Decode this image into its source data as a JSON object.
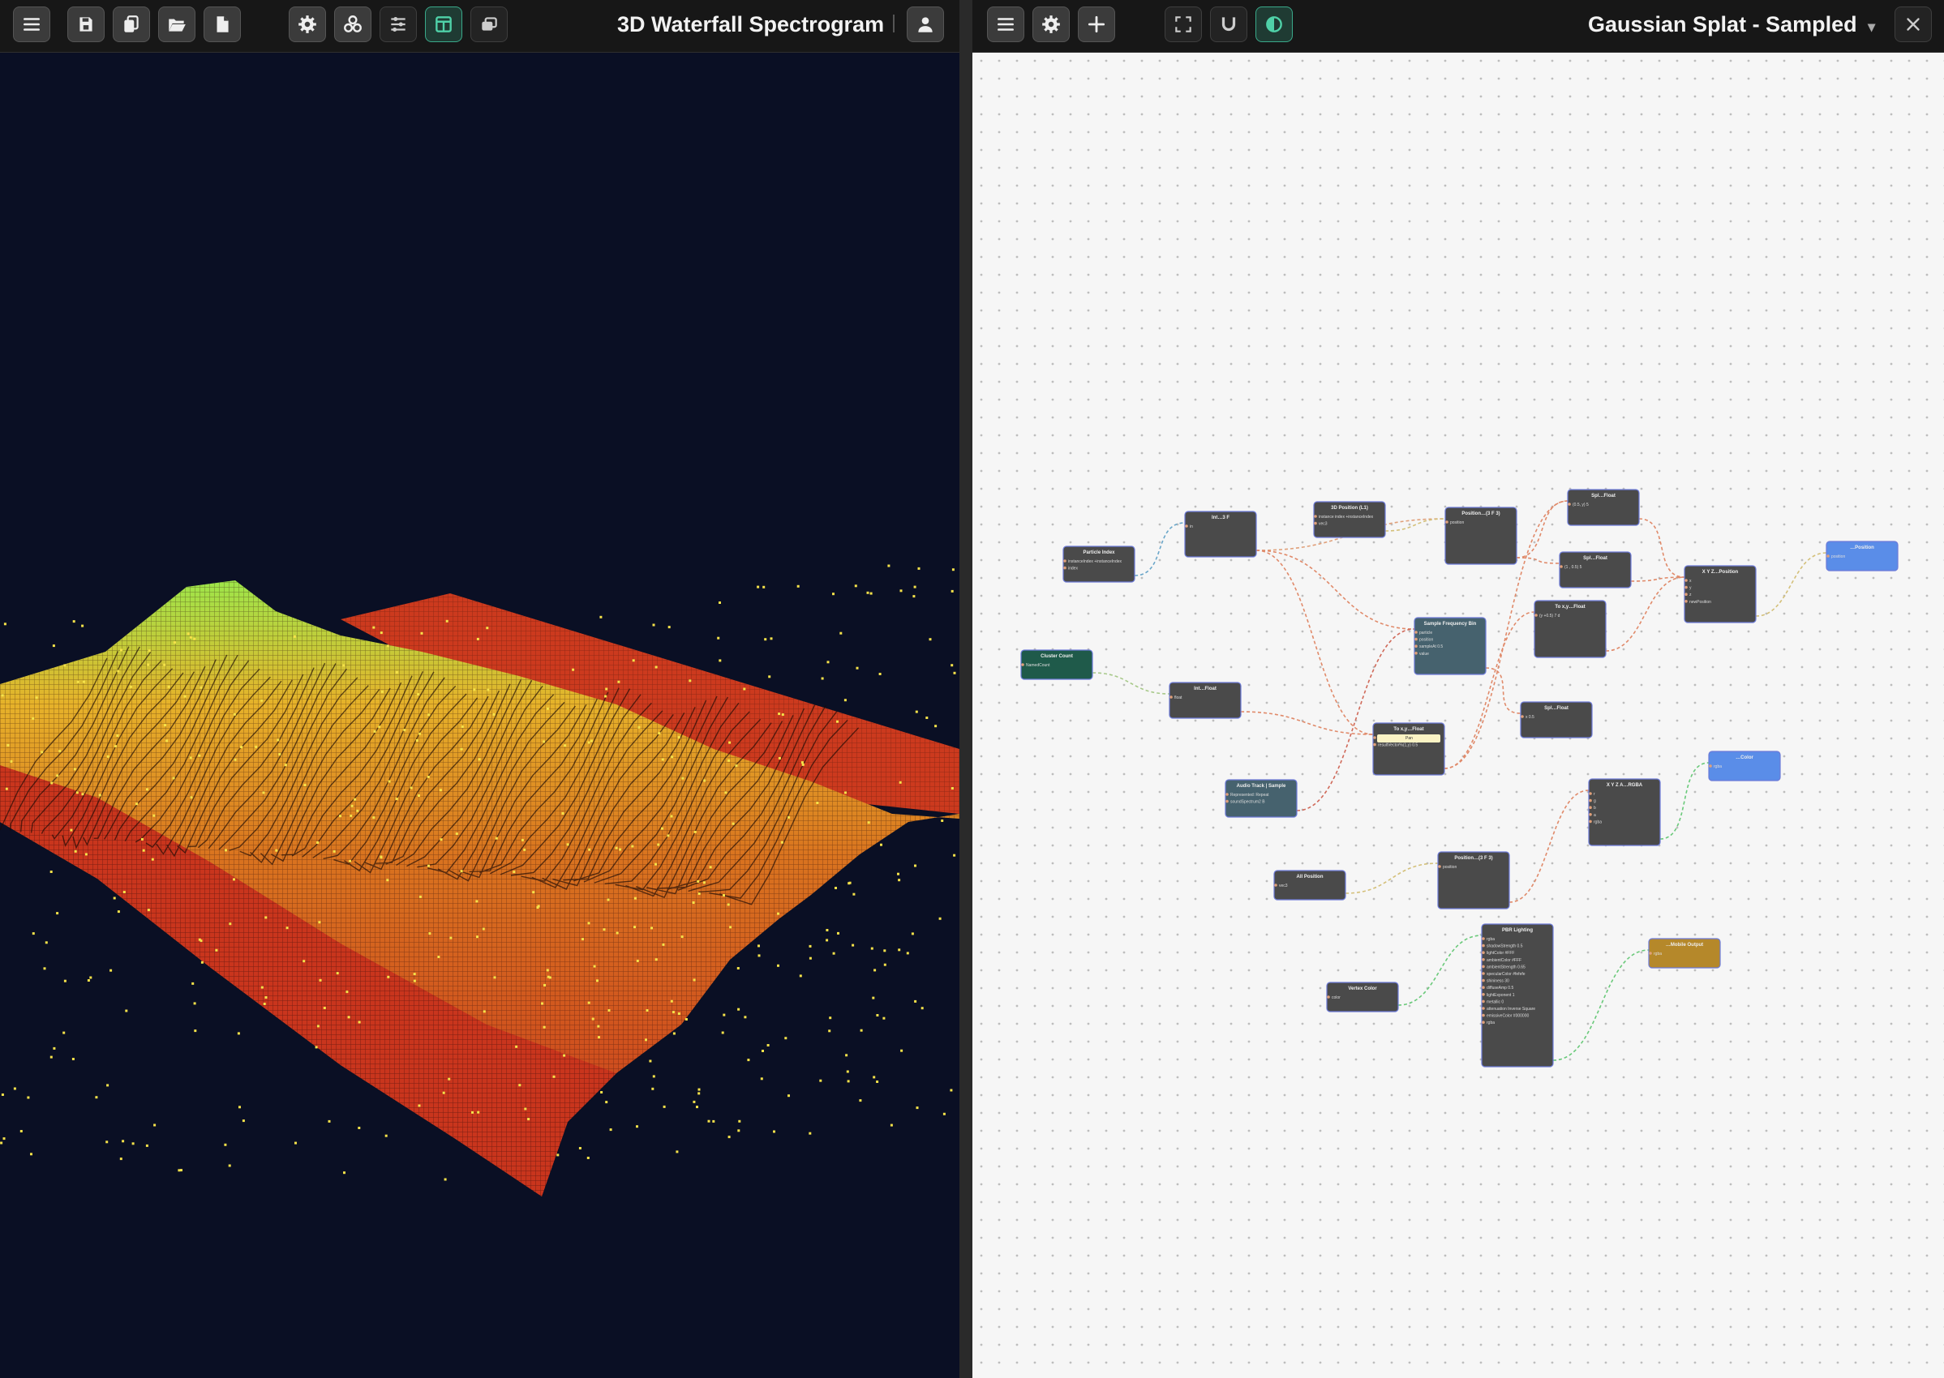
{
  "left_window": {
    "title": "3D Waterfall Spectrogram",
    "toolbar_icons": [
      "menu-icon",
      "save-icon",
      "copy-icon",
      "folder-open-icon",
      "file-icon",
      "gear-icon",
      "nodes-icon",
      "sliders-icon",
      "layout-split-icon",
      "windows-icon",
      "user-icon"
    ],
    "colors": {
      "background": "#0a0f24",
      "low": "#c8361e",
      "mid": "#e6b22a",
      "high": "#9de64a"
    }
  },
  "right_window": {
    "title": "Gaussian Splat - Sampled",
    "dropdown_arrow": "▾",
    "toolbar_icons": [
      "menu-icon",
      "gear-icon",
      "plus-icon",
      "fullscreen-icon",
      "magnet-icon",
      "contrast-icon",
      "close-icon"
    ],
    "nodes": [
      {
        "id": "n1",
        "title": "Particle Index",
        "lines": [
          "instanceIndex +instanceIndex",
          "index"
        ]
      },
      {
        "id": "n2",
        "title": "Int…3 F",
        "lines": [
          "in"
        ]
      },
      {
        "id": "n3",
        "title": "3D Position (L1)",
        "lines": [
          "instance index +instanceIndex",
          "vec3"
        ]
      },
      {
        "id": "n4",
        "title": "Position…(3 F 3)",
        "lines": [
          "position"
        ]
      },
      {
        "id": "n5",
        "title": "Spl…Float",
        "lines": [
          "(0.5, y) 5"
        ]
      },
      {
        "id": "n6",
        "title": "Spl…Float",
        "lines": [
          "(1 , 0.5) 5"
        ]
      },
      {
        "id": "n7",
        "title": "X Y Z…Position",
        "lines": [
          "x",
          "y",
          "z",
          "newPosition"
        ]
      },
      {
        "id": "n8",
        "title": "…Position",
        "lines": [
          "position"
        ]
      },
      {
        "id": "n9",
        "title": "Cluster Count",
        "lines": [
          "NamedCount"
        ]
      },
      {
        "id": "n10",
        "title": "Int…Float",
        "lines": [
          "float"
        ]
      },
      {
        "id": "n11",
        "title": "Sample Frequency Bin",
        "lines": [
          "particle",
          "position",
          "sampleAt 0.5",
          "value"
        ]
      },
      {
        "id": "n12",
        "title": "To x,y…Float",
        "lines": [
          "(y +0.5) 7 d"
        ]
      },
      {
        "id": "n13",
        "title": "Spl…Float",
        "lines": [
          "x 0.5"
        ]
      },
      {
        "id": "n14",
        "title": "To x,y…Float",
        "lines": [
          "Pan",
          "resultVector%(1,y) 0.5"
        ]
      },
      {
        "id": "n15",
        "title": "Audio Track | Sample",
        "lines": [
          "Represented: Repeat",
          "soundSpectrum2 B"
        ]
      },
      {
        "id": "n16",
        "title": "X Y Z A…RGBA",
        "lines": [
          "r",
          "g",
          "b",
          "a",
          "rgba"
        ]
      },
      {
        "id": "n17",
        "title": "…Color",
        "lines": [
          "rgba"
        ]
      },
      {
        "id": "n18",
        "title": "All Position",
        "lines": [
          "vec3"
        ]
      },
      {
        "id": "n19",
        "title": "Position…(3 F 3)",
        "lines": [
          "position"
        ]
      },
      {
        "id": "n20",
        "title": "PBR Lighting",
        "lines": [
          "rgba",
          "shadowStrength 0.5",
          "lightColor #FFF",
          "ambientColor #FFF",
          "ambientStrength 0.65",
          "specularColor #fefefe",
          "shininess 30",
          "diffuseAmp 0.5",
          "lightExponent 1",
          "metallic 0",
          "attenuation Inverse Square",
          "emissiveColor #000000",
          "rgba"
        ]
      },
      {
        "id": "n21",
        "title": "Vertex Color",
        "lines": [
          "color"
        ]
      },
      {
        "id": "n22",
        "title": "…Mobile Output",
        "lines": [
          "rgba"
        ]
      }
    ]
  }
}
